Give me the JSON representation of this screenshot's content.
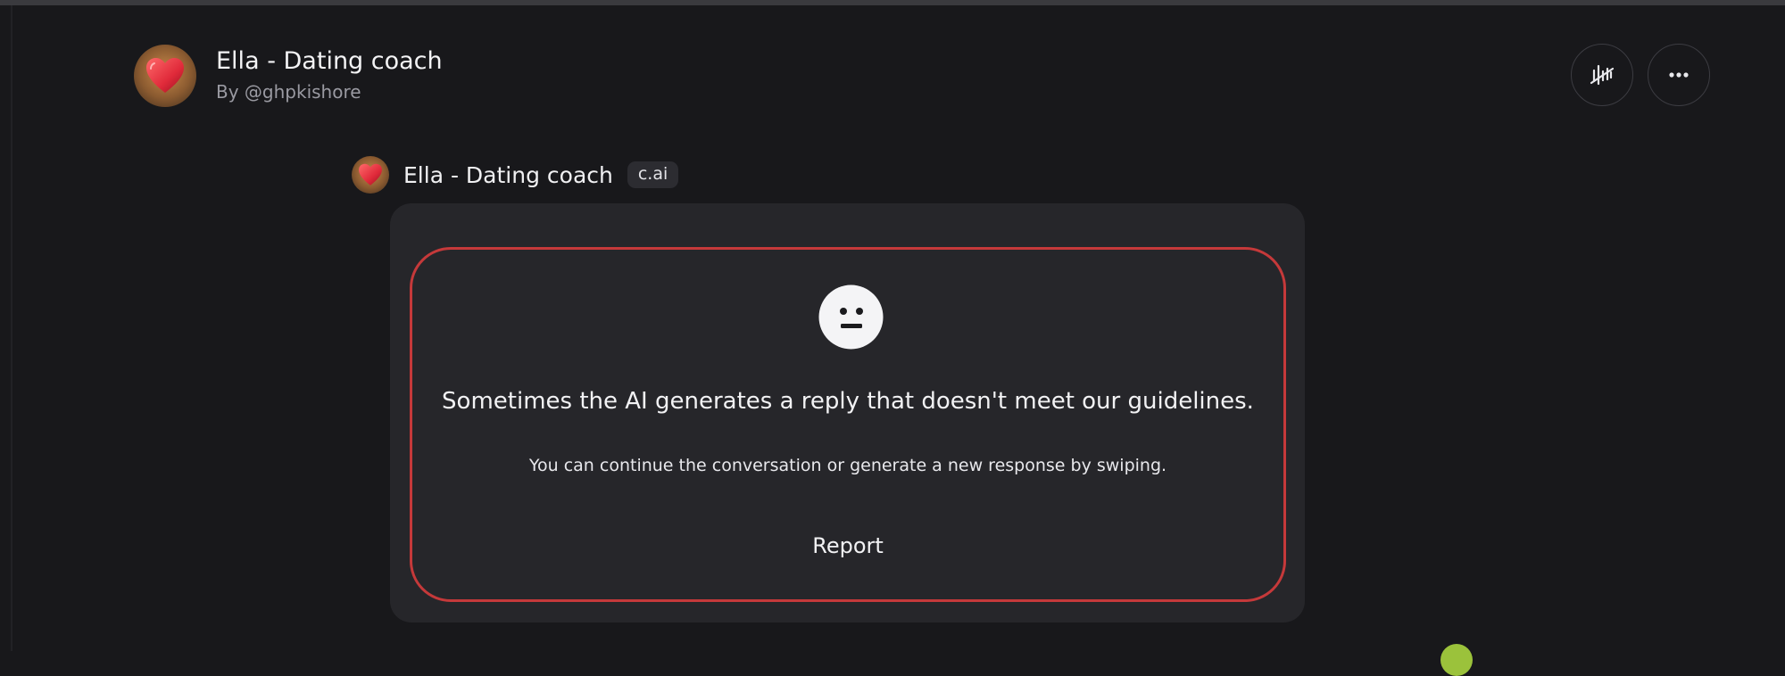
{
  "header": {
    "title": "Ella - Dating coach",
    "byline": "By @ghpkishore",
    "avatar_icon": "heart-icon",
    "voice_button_icon": "voice-waveform-icon",
    "more_button_icon": "more-horizontal-icon"
  },
  "message": {
    "author": "Ella - Dating coach",
    "badge": "c.ai",
    "warning": {
      "icon": "neutral-face-icon",
      "title": "Sometimes the AI generates a reply that doesn't meet our guidelines.",
      "subtitle": "You can continue the conversation or generate a new response by swiping.",
      "report_label": "Report",
      "border_color": "#c5393a"
    }
  },
  "colors": {
    "background": "#18181b",
    "bubble": "#26262a",
    "badge_bg": "#2c2c31",
    "accent_green": "#9bc23b"
  }
}
